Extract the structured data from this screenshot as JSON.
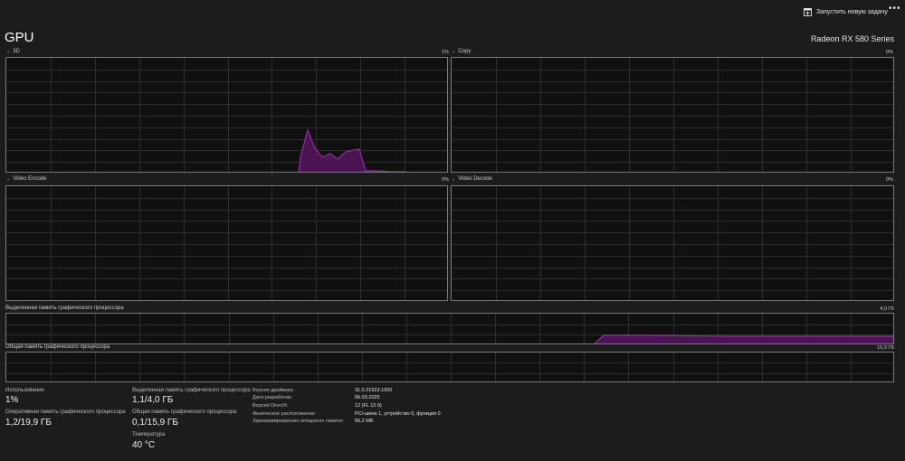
{
  "header": {
    "run_task_label": "Запустить новую задачу",
    "run_task_icon": "run-task-icon",
    "more_label": "•••",
    "title": "GPU",
    "device_name": "Radeon RX 580 Series"
  },
  "engines": [
    {
      "name": "3D",
      "percent": "1%"
    },
    {
      "name": "Copy",
      "percent": "0%"
    },
    {
      "name": "Video Encode",
      "percent": "0%"
    },
    {
      "name": "Video Decode",
      "percent": "0%"
    }
  ],
  "memory_graphs": {
    "dedicated": {
      "label": "Выделенная память графического процессора",
      "max": "4,0 ГБ"
    },
    "shared": {
      "label": "Общая память графического процессора",
      "max": "15,9 ГБ"
    }
  },
  "stats": {
    "usage": {
      "label": "Использование",
      "value": "1%"
    },
    "gpu_memory": {
      "label": "Оперативная память графического процессора",
      "value": "1,2/19,9 ГБ"
    },
    "dedicated": {
      "label": "Выделенная память графического процессора",
      "value": "1,1/4,0 ГБ"
    },
    "shared": {
      "label": "Общая память графического процессора",
      "value": "0,1/15,9 ГБ"
    },
    "temperature": {
      "label": "Температура",
      "value": "40 °C"
    }
  },
  "info": [
    {
      "key": "Версия драйвера:",
      "value": "31.0.21923.1000"
    },
    {
      "key": "Дата разработки:",
      "value": "06.03.2025"
    },
    {
      "key": "Версия DirectX:",
      "value": "12 (FL 12.0)"
    },
    {
      "key": "Физическое расположение:",
      "value": "PCI-шина 1, устройство 0, функция 0"
    },
    {
      "key": "Зарезервированная аппаратно памяти:",
      "value": "56,2 МБ"
    }
  ],
  "colors": {
    "accent": "#9b2aa8",
    "accent_fill": "#4b1552",
    "grid": "#2f2f2f",
    "border": "#7a7a7a"
  }
}
